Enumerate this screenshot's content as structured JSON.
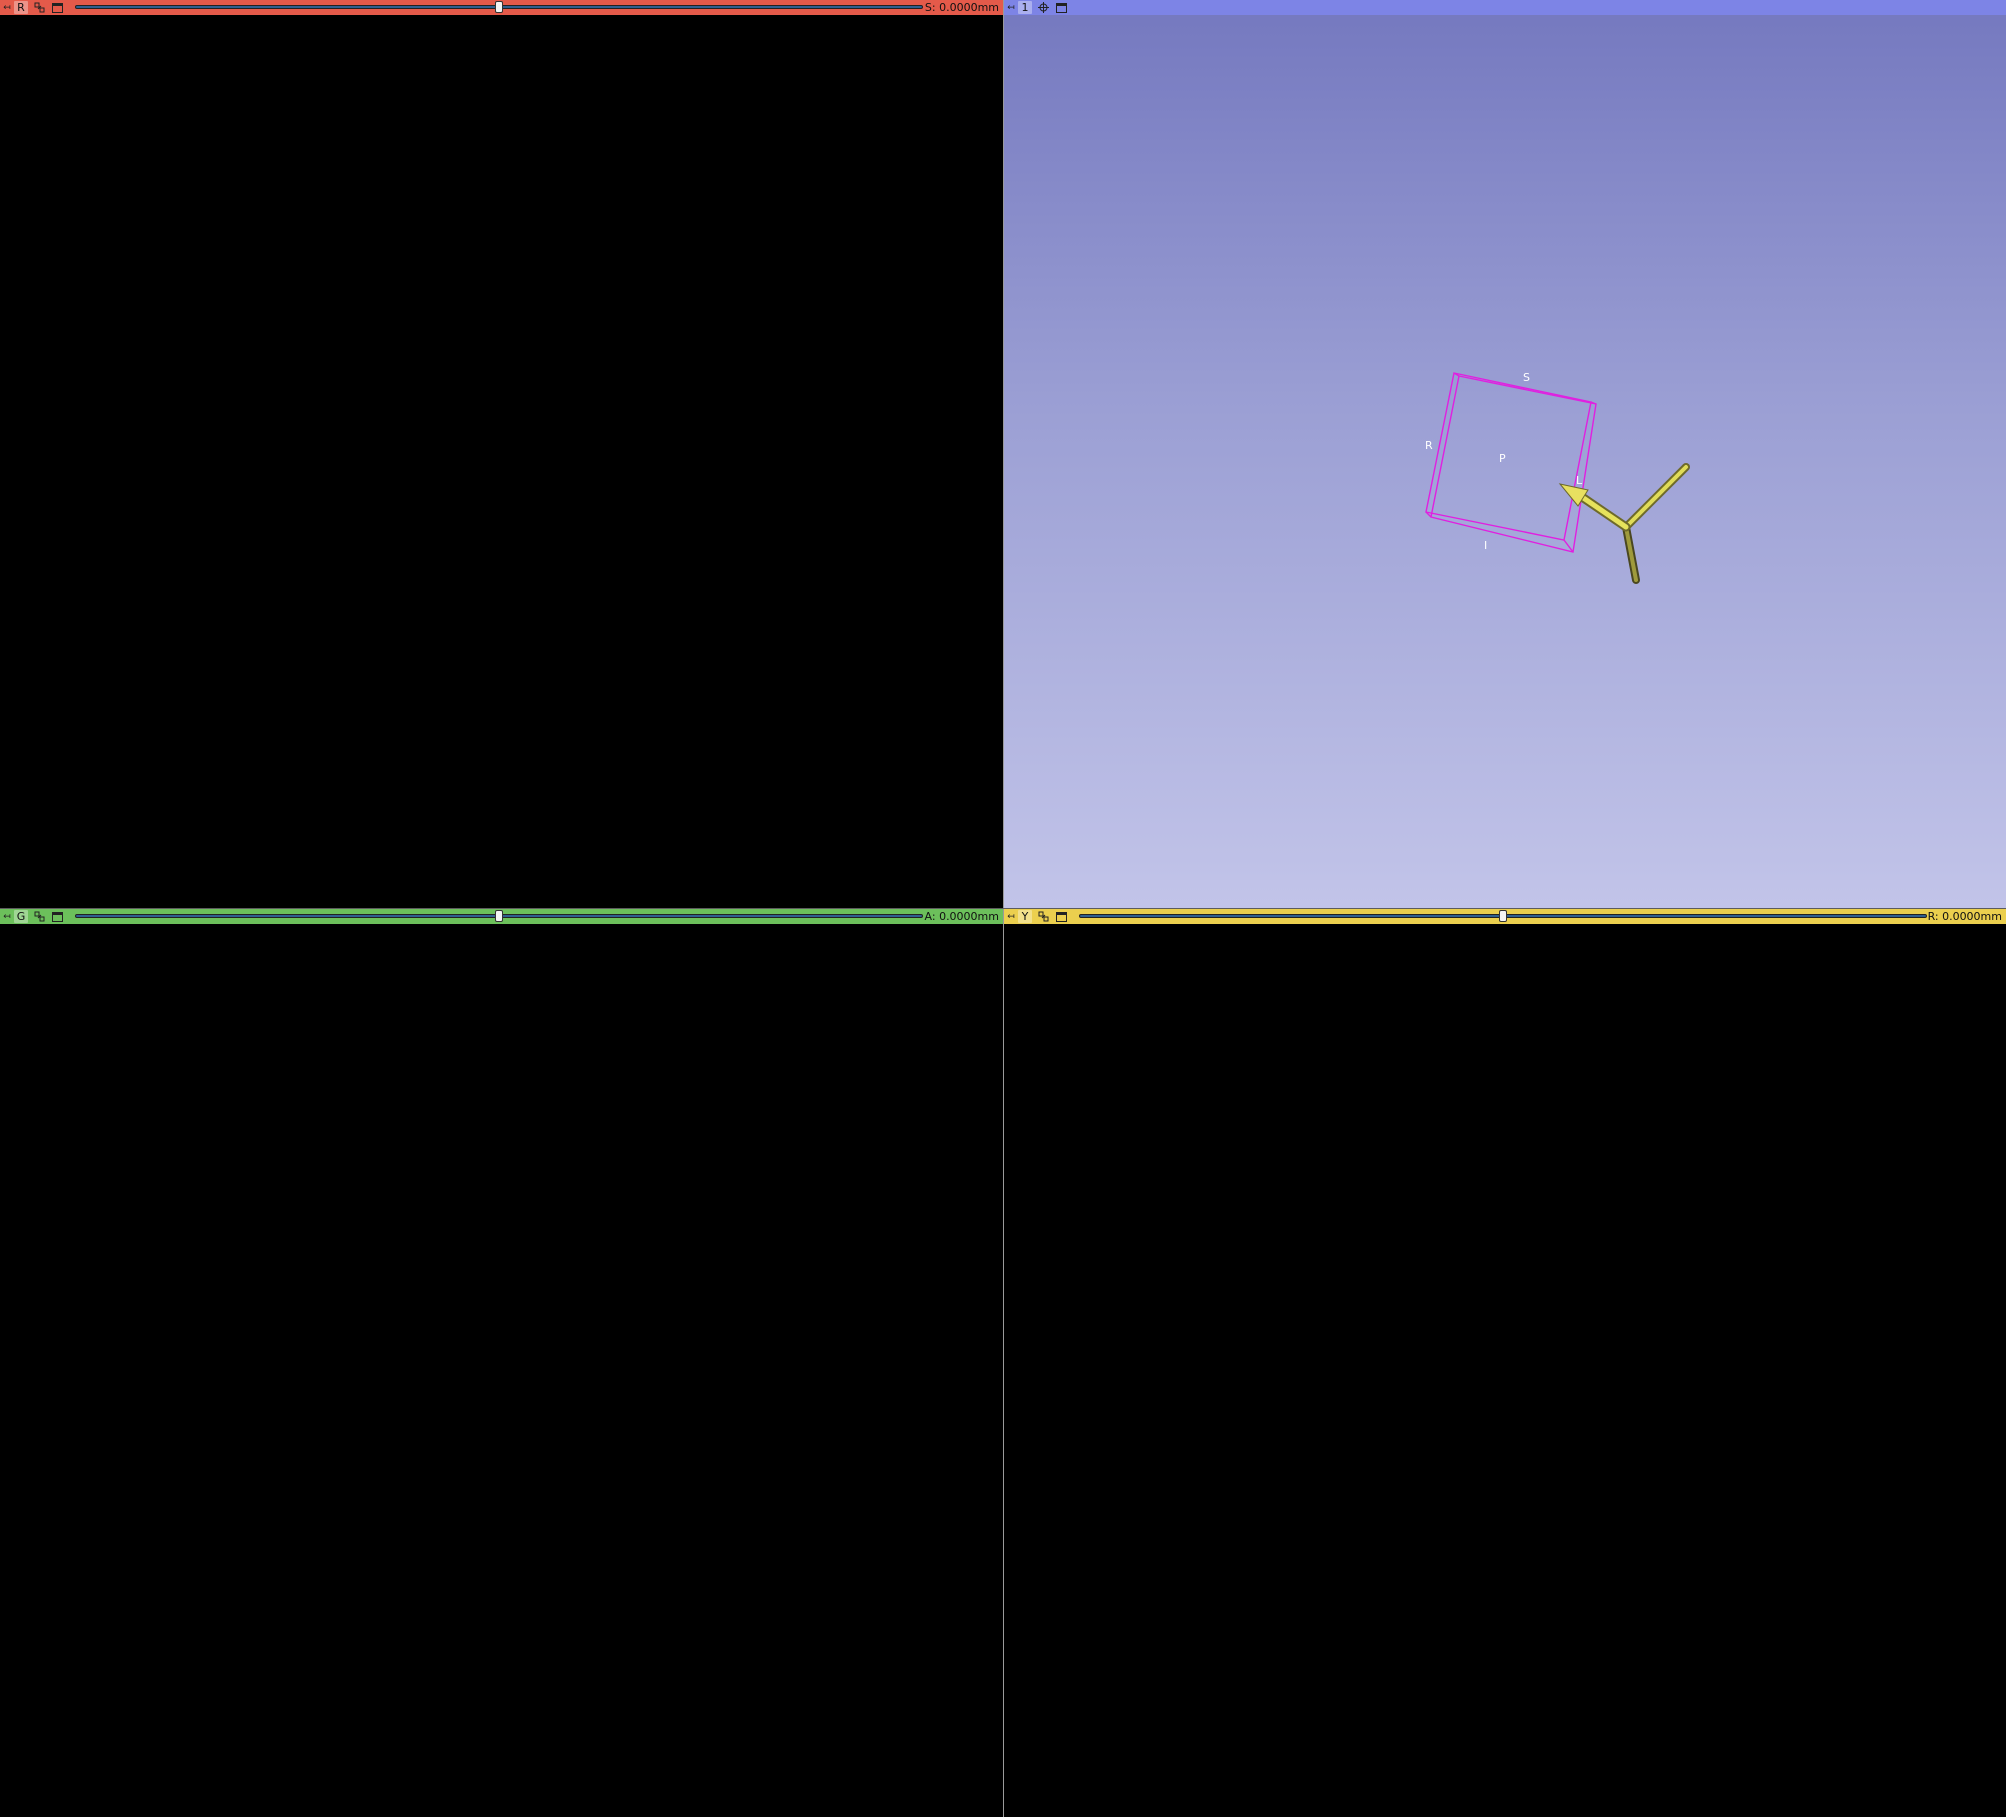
{
  "views": {
    "red": {
      "label": "R",
      "color": "#e45a4a",
      "slider_position": 0.5,
      "offset_text": "S: 0.0000mm"
    },
    "three_d": {
      "label": "1",
      "color": "#7d84e6",
      "orientation_labels": {
        "superior": "S",
        "right": "R",
        "posterior": "P",
        "left": "L",
        "inferior": "I"
      }
    },
    "green": {
      "label": "G",
      "color": "#6cc05b",
      "slider_position": 0.5,
      "offset_text": "A: 0.0000mm"
    },
    "yellow": {
      "label": "Y",
      "color": "#ebcf4e",
      "slider_position": 0.5,
      "offset_text": "R: 0.0000mm"
    }
  },
  "icons": {
    "pin": "pin-icon",
    "link": "link-icon",
    "center": "center-view-icon",
    "maximize": "maximize-view-icon"
  }
}
